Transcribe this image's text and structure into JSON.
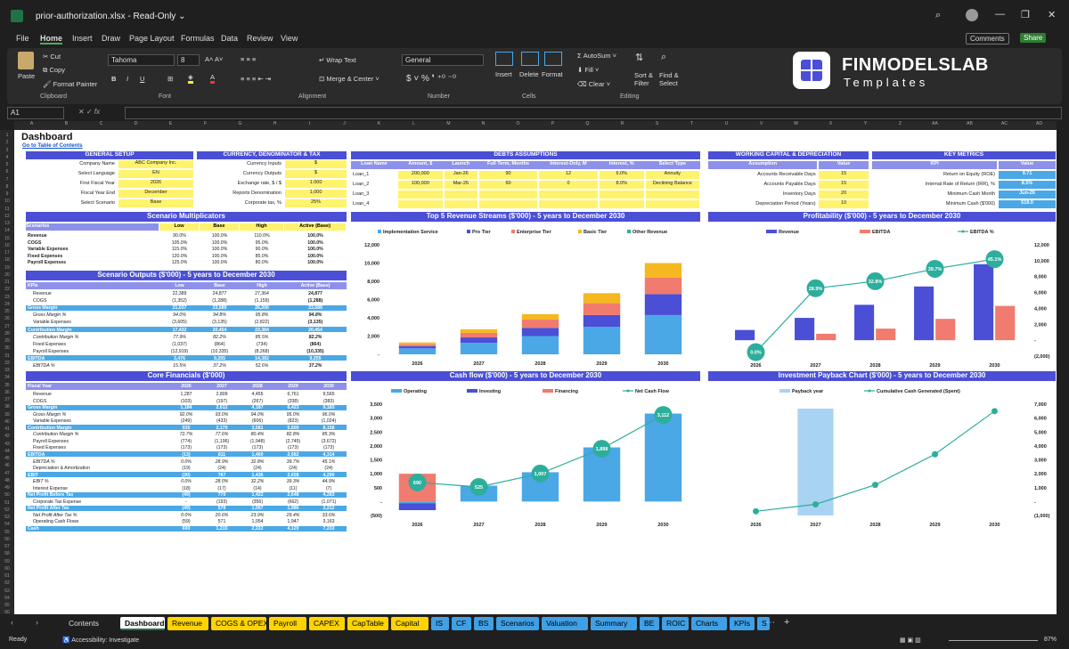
{
  "window": {
    "file_title": "prior-authorization.xlsx",
    "mode": "Read-Only"
  },
  "menu": [
    "File",
    "Home",
    "Insert",
    "Draw",
    "Page Layout",
    "Formulas",
    "Data",
    "Review",
    "View"
  ],
  "top_buttons": {
    "comments": "Comments",
    "share": "Share"
  },
  "ribbon": {
    "paste": "Paste",
    "cut": "Cut",
    "copy": "Copy",
    "format_painter": "Format Painter",
    "clipboard": "Clipboard",
    "font_name": "Tahoma",
    "font_size": "8",
    "font": "Font",
    "wrap": "Wrap Text",
    "merge": "Merge & Center",
    "alignment": "Alignment",
    "number_format": "General",
    "number": "Number",
    "insert": "Insert",
    "delete": "Delete",
    "format": "Format",
    "cells": "Cells",
    "autosum": "AutoSum",
    "fill": "Fill",
    "clear": "Clear",
    "sort": "Sort & Filter",
    "find": "Find & Select",
    "editing": "Editing",
    "brand": "FINMODELSLAB",
    "brand_sub": "Templates"
  },
  "name_box": "A1",
  "formula_fx": "fx",
  "columns": [
    "A",
    "B",
    "C",
    "D",
    "E",
    "F",
    "G",
    "H",
    "I",
    "J",
    "K",
    "L",
    "M",
    "N",
    "O",
    "P",
    "Q",
    "R",
    "S",
    "T",
    "U",
    "V",
    "W",
    "X",
    "Y",
    "Z",
    "AA",
    "AB",
    "AC",
    "AD"
  ],
  "sheet": {
    "title": "Dashboard",
    "toc_link": "Go to Table of Contents",
    "general": {
      "header": "GENERAL SETUP",
      "rows": [
        [
          "Company Name",
          "ABC Company Inc."
        ],
        [
          "Select Language",
          "EN"
        ],
        [
          "First Fiscal Year",
          "2026"
        ],
        [
          "Fiscal Year End",
          "December"
        ],
        [
          "Select Scenario",
          "Base"
        ]
      ]
    },
    "currency": {
      "header": "CURRENCY, DENOMINATOR & TAX",
      "rows": [
        [
          "Currency Inputs",
          "$"
        ],
        [
          "Currency Outputs",
          "$"
        ],
        [
          "Exchange rate, $ / $",
          "1.000"
        ],
        [
          "Reports Denomination",
          "1,000"
        ],
        [
          "Corporate tax, %",
          "25%"
        ]
      ]
    },
    "debts": {
      "header": "DEBTS ASSUMPTIONS",
      "cols": [
        "Loan Name",
        "Amount, $",
        "Launch",
        "Full Term, Months",
        "Interest-Only, M",
        "Interest, %",
        "Select Type"
      ],
      "rows": [
        [
          "Loan_1",
          "200,000",
          "Jan-26",
          "90",
          "12",
          "6.0%",
          "Annuity"
        ],
        [
          "Loan_2",
          "100,000",
          "Mar-26",
          "60",
          "0",
          "8.0%",
          "Declining Balance"
        ],
        [
          "Loan_3",
          "",
          "",
          "",
          "",
          "",
          ""
        ],
        [
          "Loan_4",
          "",
          "",
          "",
          "",
          "",
          ""
        ]
      ]
    },
    "wc": {
      "header": "WORKING CAPITAL & DEPRECIATION",
      "cols": [
        "Assumption",
        "Value"
      ],
      "rows": [
        [
          "Accounts Receivable Days",
          "15"
        ],
        [
          "Accounts Payable Days",
          "15"
        ],
        [
          "Inventory Days",
          "20"
        ],
        [
          "Depreciation Period (Years)",
          "10"
        ]
      ]
    },
    "km": {
      "header": "KEY METRICS",
      "cols": [
        "KPI",
        "Value"
      ],
      "rows": [
        [
          "Return on Equity (ROE)",
          "9.71"
        ],
        [
          "Internal Rate of Return (IRR), %",
          "8.5%"
        ],
        [
          "Minimum Cash Month",
          "Jun-26"
        ],
        [
          "Minimum Cash ($'000)",
          "519.0"
        ]
      ]
    },
    "scen_mult": {
      "title": "Scenario Multiplicators",
      "cols": [
        "Scenarios",
        "Low",
        "Base",
        "High",
        "Active (Base)"
      ],
      "rows": [
        [
          "Revenue",
          "90.0%",
          "100.0%",
          "110.0%",
          "100.0%"
        ],
        [
          "COGS",
          "105.0%",
          "100.0%",
          "95.0%",
          "100.0%"
        ],
        [
          "Variable Expenses",
          "115.0%",
          "100.0%",
          "90.0%",
          "100.0%"
        ],
        [
          "Fixed Expenses",
          "120.0%",
          "100.0%",
          "85.0%",
          "100.0%"
        ],
        [
          "Payroll Expenses",
          "125.0%",
          "100.0%",
          "80.0%",
          "100.0%"
        ]
      ]
    },
    "scen_out": {
      "title": "Scenario Outputs ($'000) - 5 years to December 2030",
      "cols": [
        "KPIs",
        "Low",
        "Base",
        "High",
        "Active (Base)"
      ],
      "rows": [
        [
          "Revenue",
          "22,389",
          "24,877",
          "27,364",
          "24,877",
          0
        ],
        [
          "COGS",
          "(1,352)",
          "(1,288)",
          "(1,159)",
          "(1,288)",
          0
        ],
        [
          "Gross Margin",
          "21,037",
          "23,589",
          "26,206",
          "23,589",
          1
        ],
        [
          "Gross Margin %",
          "94.0%",
          "94.8%",
          "95.8%",
          "94.8%",
          0
        ],
        [
          "Variable Expenses",
          "(3,605)",
          "(3,135)",
          "(2,822)",
          "(3,135)",
          0
        ],
        [
          "Contribution Margin",
          "17,432",
          "20,454",
          "23,384",
          "20,454",
          1
        ],
        [
          "Contribution Margin %",
          "77.9%",
          "82.2%",
          "85.5%",
          "82.2%",
          0
        ],
        [
          "Fixed Expenses",
          "(1,037)",
          "(864)",
          "(734)",
          "(864)",
          0
        ],
        [
          "Payroll Expenses",
          "(12,919)",
          "(10,335)",
          "(8,268)",
          "(10,335)",
          0
        ],
        [
          "EBITDA",
          "3,476",
          "9,255",
          "14,382",
          "9,255",
          1
        ],
        [
          "EBITDA %",
          "15.5%",
          "37.2%",
          "52.6%",
          "37.2%",
          0
        ]
      ]
    },
    "core": {
      "title": "Core Financials ($'000)",
      "cols": [
        "Fiscal Year",
        "2026",
        "2027",
        "2028",
        "2029",
        "2030"
      ],
      "rows": [
        [
          "Revenue",
          "1,287",
          "2,809",
          "4,455",
          "6,761",
          "9,565",
          0
        ],
        [
          "COGS",
          "(103)",
          "(197)",
          "(267)",
          "(338)",
          "(383)",
          0
        ],
        [
          "Gross Margin",
          "1,184",
          "2,612",
          "4,187",
          "6,423",
          "9,183",
          1
        ],
        [
          "Gross Margin %",
          "92.0%",
          "93.0%",
          "94.0%",
          "95.0%",
          "96.0%",
          0
        ],
        [
          "Variable Expenses",
          "(249)",
          "(433)",
          "(606)",
          "(823)",
          "(1,024)",
          0
        ],
        [
          "Contribution Margin",
          "935",
          "2,179",
          "3,581",
          "5,600",
          "8,158",
          1
        ],
        [
          "Contribution Margin %",
          "72.7%",
          "77.6%",
          "80.4%",
          "82.8%",
          "85.3%",
          0
        ],
        [
          "Payroll Expenses",
          "(774)",
          "(1,196)",
          "(1,948)",
          "(2,745)",
          "(3,672)",
          0
        ],
        [
          "Fixed Expenses",
          "(173)",
          "(173)",
          "(173)",
          "(173)",
          "(173)",
          0
        ],
        [
          "EBITDA",
          "(13)",
          "811",
          "1,460",
          "2,682",
          "4,314",
          1
        ],
        [
          "EBITDA %",
          "0.0%",
          "28.9%",
          "32.8%",
          "39.7%",
          "45.1%",
          0
        ],
        [
          "Depreciation & Amortization",
          "(19)",
          "(24)",
          "(24)",
          "(24)",
          "(24)",
          0
        ],
        [
          "EBIT",
          "(30)",
          "787",
          "1,436",
          "2,658",
          "4,290",
          1
        ],
        [
          "EBIT %",
          "0.0%",
          "28.0%",
          "32.2%",
          "39.3%",
          "44.9%",
          0
        ],
        [
          "Interest Expense",
          "(18)",
          "(17)",
          "(14)",
          "(11)",
          "(7)",
          0
        ],
        [
          "Net Profit Before Tax",
          "(49)",
          "770",
          "1,422",
          "2,648",
          "4,283",
          1
        ],
        [
          "Corporate Tax Expense",
          "-",
          "(193)",
          "(356)",
          "(662)",
          "(1,071)",
          0
        ],
        [
          "Net Profit After Tax",
          "(49)",
          "578",
          "1,067",
          "1,986",
          "3,212",
          1
        ],
        [
          "Net Profit After Tax %",
          "0.0%",
          "20.6%",
          "23.9%",
          "29.4%",
          "33.6%",
          0
        ],
        [
          "Operating Cash Flows",
          "(59)",
          "571",
          "1,054",
          "1,947",
          "3,163",
          0
        ],
        [
          "Cash",
          "690",
          "1,215",
          "2,222",
          "4,120",
          "7,233",
          1
        ]
      ]
    }
  },
  "chart_data": [
    {
      "type": "bar",
      "title": "Top 5 Revenue Streams ($'000) - 5 years to December 2030",
      "categories": [
        "2026",
        "2027",
        "2028",
        "2029",
        "2030"
      ],
      "ylim": [
        0,
        12000
      ],
      "series": [
        {
          "name": "Implementation Service",
          "values": [
            650,
            1250,
            2000,
            3000,
            4300
          ]
        },
        {
          "name": "Pro Tier",
          "values": [
            250,
            600,
            900,
            1300,
            2300
          ]
        },
        {
          "name": "Enterprise Tier",
          "values": [
            200,
            500,
            900,
            1300,
            1800
          ]
        },
        {
          "name": "Basic Tier",
          "values": [
            200,
            400,
            600,
            1100,
            1600
          ]
        },
        {
          "name": "Other Revenue",
          "values": [
            0,
            0,
            0,
            0,
            0
          ]
        }
      ],
      "yticks": [
        "-",
        "2,000",
        "4,000",
        "6,000",
        "8,000",
        "10,000",
        "12,000"
      ]
    },
    {
      "type": "bar",
      "title": "Profitability ($'000) - 5 years to December 2030",
      "categories": [
        "2026",
        "2027",
        "2028",
        "2029",
        "2030"
      ],
      "ylim": [
        -2000,
        12000
      ],
      "series": [
        {
          "name": "Revenue",
          "values": [
            1287,
            2809,
            4455,
            6761,
            9565
          ]
        },
        {
          "name": "EBITDA",
          "values": [
            -13,
            811,
            1460,
            2682,
            4314
          ]
        },
        {
          "name": "EBITDA %",
          "values": [
            0.0,
            28.9,
            32.8,
            39.7,
            45.1
          ]
        }
      ],
      "yticks": [
        "(2,000)",
        "-",
        "2,000",
        "4,000",
        "6,000",
        "8,000",
        "10,000",
        "12,000"
      ],
      "point_labels": [
        "0.0%",
        "28.9%",
        "32.8%",
        "39.7%",
        "45.1%"
      ]
    },
    {
      "type": "bar",
      "title": "Cash flow ($'000) - 5 years to December 2030",
      "categories": [
        "2026",
        "2027",
        "2028",
        "2029",
        "2030"
      ],
      "ylim": [
        -500,
        3500
      ],
      "series": [
        {
          "name": "Operating",
          "values": [
            -59,
            571,
            1054,
            1947,
            3163
          ]
        },
        {
          "name": "Investing",
          "values": [
            -250,
            0,
            0,
            0,
            0
          ]
        },
        {
          "name": "Financing",
          "values": [
            1000,
            0,
            0,
            0,
            0
          ]
        },
        {
          "name": "Net Cash Flow",
          "values": [
            690,
            525,
            1007,
            1898,
            3112
          ]
        }
      ],
      "yticks": [
        "(500)",
        "-",
        "500",
        "1,000",
        "1,500",
        "2,000",
        "2,500",
        "3,000",
        "3,500"
      ],
      "point_labels": [
        "690",
        "525",
        "1,007",
        "1,898",
        "3,112"
      ]
    },
    {
      "type": "line",
      "title": "Investment Payback Chart ($'000) - 5 years to December 2030",
      "categories": [
        "2026",
        "2027",
        "2028",
        "2029",
        "2030"
      ],
      "ylim": [
        -1000,
        7000
      ],
      "series": [
        {
          "name": "Payback year",
          "values": [
            0,
            1,
            0,
            0,
            0
          ]
        },
        {
          "name": "Cumulative Cash Generated (Spent)",
          "values": [
            -700,
            -200,
            1200,
            3400,
            6500
          ]
        }
      ],
      "yticks": [
        "(1,000)",
        "-",
        "1,000",
        "2,000",
        "3,000",
        "4,000",
        "5,000",
        "6,000",
        "7,000"
      ]
    }
  ],
  "tabs": [
    {
      "label": "Contents",
      "color": "#1f1f1f"
    },
    {
      "label": "Dashboard",
      "color": "#ffffff"
    },
    {
      "label": "Revenue",
      "color": "#ffd400"
    },
    {
      "label": "COGS & OPEX",
      "color": "#ffd400"
    },
    {
      "label": "Payroll",
      "color": "#ffd400"
    },
    {
      "label": "CAPEX",
      "color": "#ffd400"
    },
    {
      "label": "CapTable",
      "color": "#ffd400"
    },
    {
      "label": "Capital",
      "color": "#ffd400"
    },
    {
      "label": "IS",
      "color": "#3fa0e6"
    },
    {
      "label": "CF",
      "color": "#3fa0e6"
    },
    {
      "label": "BS",
      "color": "#3fa0e6"
    },
    {
      "label": "Scenarios",
      "color": "#3fa0e6"
    },
    {
      "label": "Valuation",
      "color": "#3fa0e6"
    },
    {
      "label": "Summary",
      "color": "#3fa0e6"
    },
    {
      "label": "BE",
      "color": "#3fa0e6"
    },
    {
      "label": "ROIC",
      "color": "#3fa0e6"
    },
    {
      "label": "Charts",
      "color": "#3fa0e6"
    },
    {
      "label": "KPIs",
      "color": "#3fa0e6"
    },
    {
      "label": "S",
      "color": "#3fa0e6"
    }
  ],
  "status": {
    "ready": "Ready",
    "accessibility": "Accessibility: Investigate",
    "zoom": "87%"
  },
  "colors": {
    "accent": "#4a4fd6",
    "light": "#8d91ea",
    "input": "#fff36e",
    "teal": "#2dae9c",
    "sky": "#4aa8e6",
    "salmon": "#f07b6e",
    "gold": "#f5b820"
  }
}
